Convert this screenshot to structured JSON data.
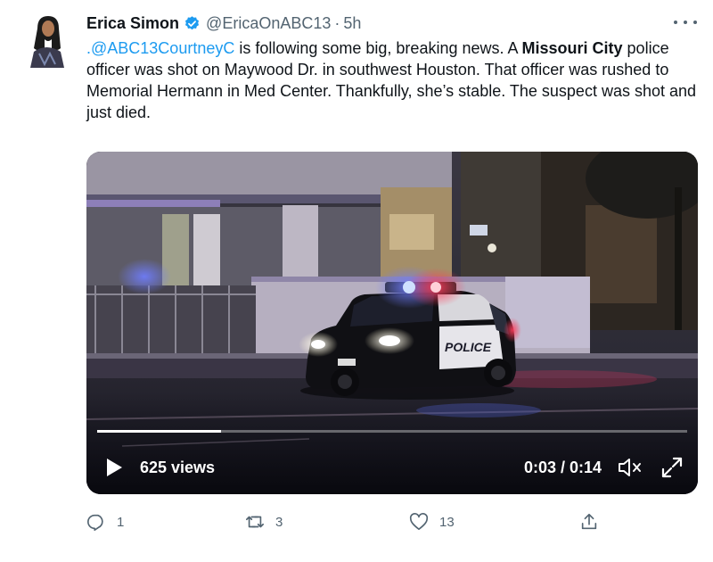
{
  "tweet": {
    "author_name": "Erica Simon",
    "handle": "@EricaOnABC13",
    "separator": "·",
    "time": "5h",
    "text": {
      "mention": ".@ABC13CourtneyC",
      "part1": " is following some big, breaking news. A ",
      "bold": "Missouri City",
      "part2": " police officer was shot on Maywood Dr. in southwest Houston. That officer was rushed to Memorial Hermann in Med Center. Thankfully, she’s stable. The suspect was shot and just died."
    }
  },
  "video": {
    "views": "625 views",
    "time": "0:03 / 0:14",
    "progress": 0.21,
    "car_text": "POLICE"
  },
  "actions": {
    "replies": "1",
    "retweets": "3",
    "likes": "13"
  },
  "icons": {
    "verified": "verified-badge-icon",
    "more": "more-dots-icon",
    "play": "play-icon",
    "mute": "muted-speaker-icon",
    "fullscreen": "fullscreen-icon",
    "reply": "reply-icon",
    "retweet": "retweet-icon",
    "like": "heart-icon",
    "share": "share-icon"
  },
  "colors": {
    "accent": "#1d9bf0",
    "muted": "#536471",
    "text": "#0f1419"
  }
}
